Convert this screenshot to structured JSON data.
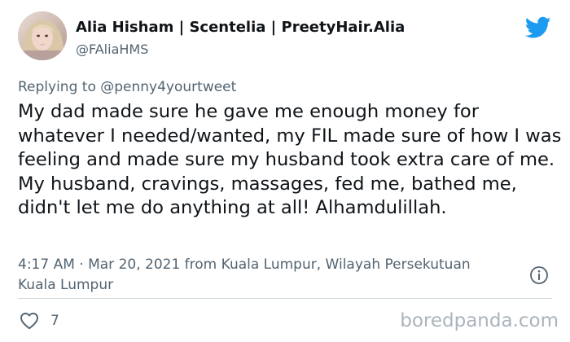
{
  "author": {
    "display_name": "Alia Hisham | Scentelia | PreetyHair.Alia",
    "handle": "@FAliaHMS"
  },
  "reply": {
    "prefix": "Replying to",
    "mention": "@penny4yourtweet"
  },
  "tweet": {
    "text": "My dad made sure he gave me enough money for whatever I needed/wanted, my FIL made sure of how I was feeling and made sure my husband took extra care of me. My husband, cravings, massages, fed me, bathed me, didn't let me do anything at all! Alhamdulillah.",
    "timestamp": "4:17 AM · Mar 20, 2021 from Kuala Lumpur, Wilayah Persekutuan Kuala Lumpur"
  },
  "actions": {
    "like_count": "7"
  },
  "watermark": "boredpanda.com",
  "colors": {
    "text_primary": "#0f1419",
    "text_secondary": "#536471",
    "twitter_blue": "#1d9bf0",
    "divider": "#cfd9de",
    "watermark": "#aab4bb"
  },
  "icons": {
    "brand": "twitter-bird-icon",
    "info": "info-circle-icon",
    "like": "heart-outline-icon"
  }
}
